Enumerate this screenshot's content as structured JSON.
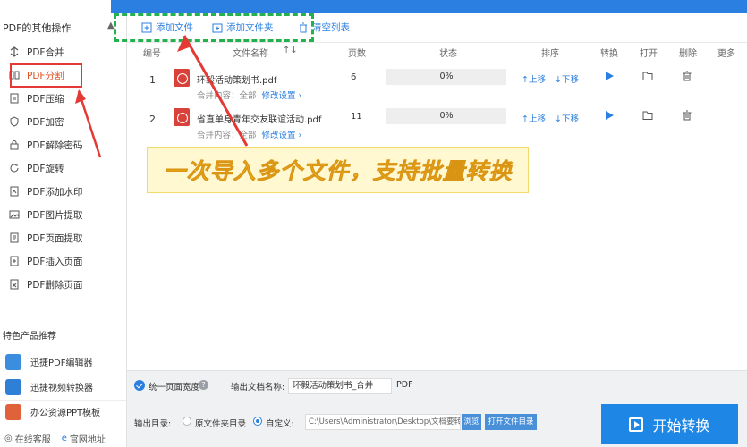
{
  "sidebar": {
    "title": "PDF的其他操作",
    "items": [
      {
        "label": "PDF合并",
        "icon": "merge-icon"
      },
      {
        "label": "PDF分割",
        "icon": "split-icon"
      },
      {
        "label": "PDF压缩",
        "icon": "compress-icon"
      },
      {
        "label": "PDF加密",
        "icon": "shield-icon"
      },
      {
        "label": "PDF解除密码",
        "icon": "lock-icon"
      },
      {
        "label": "PDF旋转",
        "icon": "rotate-icon"
      },
      {
        "label": "PDF添加水印",
        "icon": "watermark-icon"
      },
      {
        "label": "PDF图片提取",
        "icon": "image-icon"
      },
      {
        "label": "PDF页面提取",
        "icon": "page-icon"
      },
      {
        "label": "PDF插入页面",
        "icon": "insert-page-icon"
      },
      {
        "label": "PDF删除页面",
        "icon": "delete-page-icon"
      }
    ],
    "featured_title": "特色产品推荐",
    "featured": [
      {
        "label": "迅捷PDF编辑器"
      },
      {
        "label": "迅捷视频转换器"
      },
      {
        "label": "办公资源PPT模板"
      }
    ],
    "footer": {
      "service": "在线客服",
      "site": "官网地址"
    }
  },
  "toolbar": {
    "add_file": "添加文件",
    "add_folder": "添加文件夹",
    "clear_list": "清空列表"
  },
  "table": {
    "headers": [
      "编号",
      "文件名称",
      "页数",
      "状态",
      "排序",
      "转换",
      "打开",
      "删除",
      "更多"
    ],
    "rows": [
      {
        "num": "1",
        "name": "环毅活动策划书.pdf",
        "merge_label": "合并内容：全部",
        "modify": "修改设置",
        "pages": "6",
        "status": "0%",
        "up": "上移",
        "down": "下移"
      },
      {
        "num": "2",
        "name": "省直单身青年交友联谊活动.pdf",
        "merge_label": "合并内容：全部",
        "modify": "修改设置",
        "pages": "11",
        "status": "0%",
        "up": "上移",
        "down": "下移"
      }
    ]
  },
  "banner": {
    "text": "一次导入多个文件，支持批量转换"
  },
  "bottom": {
    "one_page_width": "统一页面宽度",
    "output_name_label": "输出文档名称:",
    "output_name": "环毅活动策划书_合并",
    "ext": ".PDF",
    "output_dir_label": "输出目录:",
    "radio_source": "原文件夹目录",
    "radio_custom": "自定义:",
    "path": "C:\\Users\\Administrator\\Desktop\\文档要转",
    "browse": "浏览",
    "open_folder": "打开文件目录",
    "start": "开始转换"
  },
  "colors": {
    "accent": "#2b7fe0",
    "start_button": "#1e87e6",
    "banner_text": "#f2b31a",
    "annotation_red": "#e53935",
    "annotation_green": "#22b14c"
  }
}
